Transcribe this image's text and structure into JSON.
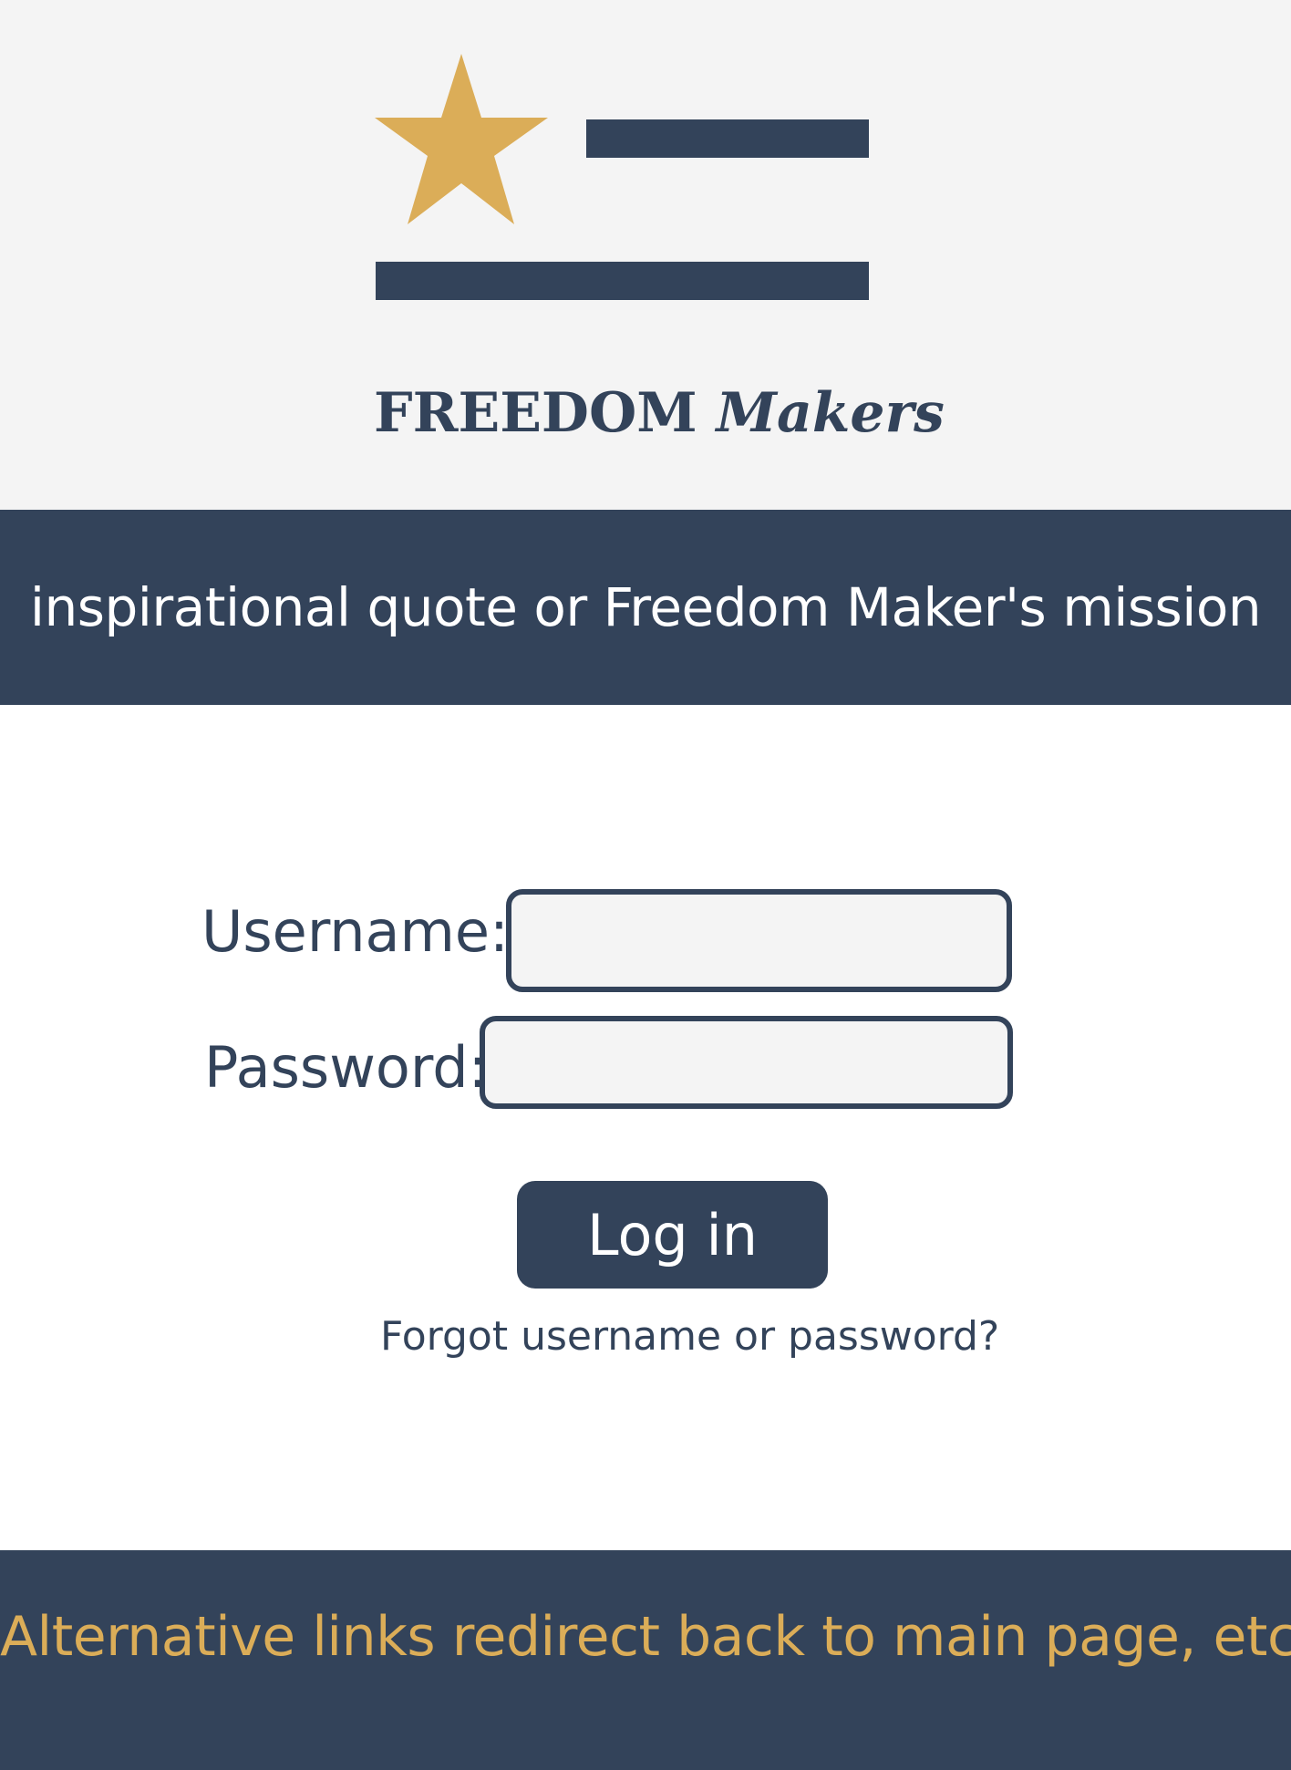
{
  "colors": {
    "navy": "#33435a",
    "gold": "#dbad58",
    "light_gray": "#f4f4f4",
    "white": "#ffffff"
  },
  "header": {
    "logo_icon": "star-and-stripes-icon",
    "brand_main": "FREEDOM",
    "brand_italic": "Makers"
  },
  "banner": {
    "text": "inspirational quote or Freedom Maker's mission"
  },
  "login": {
    "username_label": "Username:",
    "username_value": "",
    "password_label": "Password:",
    "password_value": "",
    "login_button": "Log in",
    "forgot_link": "Forgot username or password?"
  },
  "footer": {
    "text": "Alternative links redirect back to main page, etc."
  }
}
